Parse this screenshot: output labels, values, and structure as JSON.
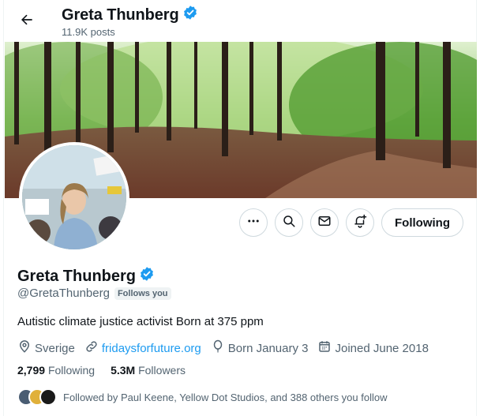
{
  "header": {
    "title": "Greta Thunberg",
    "post_count": "11.9K posts"
  },
  "profile": {
    "display_name": "Greta Thunberg",
    "handle": "@GretaThunberg",
    "follows_you_badge": "Follows you",
    "bio": "Autistic climate justice activist Born at 375 ppm",
    "location": "Sverige",
    "website": "fridaysforfuture.org",
    "birthday": "Born January 3",
    "joined": "Joined June 2018",
    "verified": true,
    "verified_color": "#1d9bf0"
  },
  "actions": {
    "follow_label": "Following",
    "more_icon": "more-icon",
    "search_icon": "search-icon",
    "message_icon": "envelope-icon",
    "notify_icon": "bell-plus-icon"
  },
  "stats": {
    "following_count": "2,799",
    "following_label": "Following",
    "followers_count": "5.3M",
    "followers_label": "Followers"
  },
  "followed_by": {
    "text": "Followed by Paul Keene, Yellow Dot Studios, and 388 others you follow"
  },
  "colors": {
    "accent": "#1d9bf0",
    "text_primary": "#0f1419",
    "text_secondary": "#536471"
  }
}
